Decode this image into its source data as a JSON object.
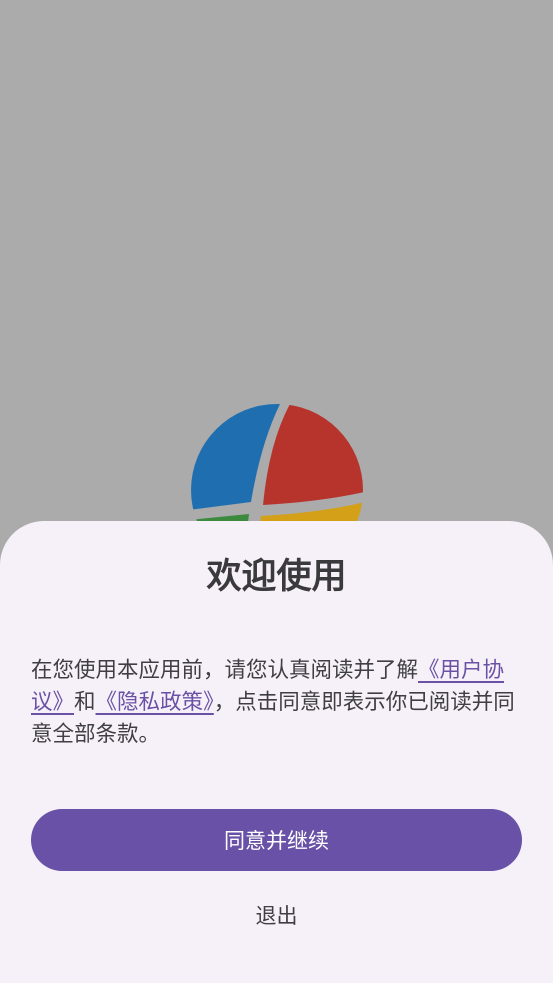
{
  "colors": {
    "background": "#ababab",
    "sheet": "#f6f1f8",
    "accent": "#6851a6",
    "link": "#6a51a5",
    "logo_blue": "#1f6fb0",
    "logo_red": "#b7342c",
    "logo_green": "#3b8a3e",
    "logo_yellow": "#d4a017"
  },
  "splash": {
    "logo_icon": "four-segment-globe-icon"
  },
  "dialog": {
    "title": "欢迎使用",
    "text_before": "在您使用本应用前，请您认真阅读并了解",
    "user_agreement_link": "《用户协议》",
    "and_text": "和",
    "privacy_policy_link": "《隐私政策》",
    "text_after": "，点击同意即表示你已阅读并同意全部条款。",
    "agree_button": "同意并继续",
    "exit_button": "退出"
  }
}
